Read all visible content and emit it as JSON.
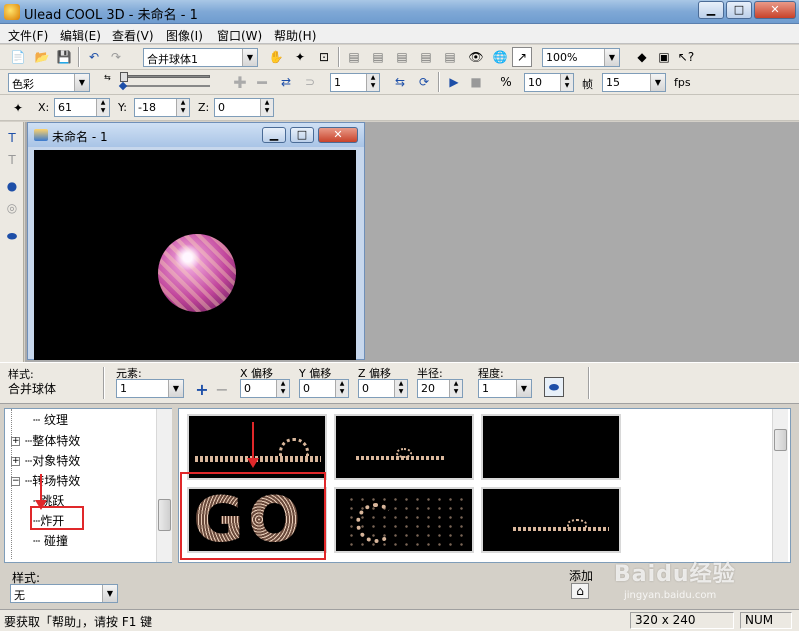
{
  "window": {
    "title": "Ulead COOL 3D - 未命名 - 1"
  },
  "menu": [
    "文件(F)",
    "编辑(E)",
    "查看(V)",
    "图像(I)",
    "窗口(W)",
    "帮助(H)"
  ],
  "toolbar1": {
    "object_combo": "合并球体1",
    "zoom_combo": "100%"
  },
  "toolbar2": {
    "color_combo": "色彩",
    "frame_value": "1",
    "frame_rate_value": "10",
    "frame_label": "帧",
    "fps_value": "15",
    "fps_label": "fps"
  },
  "toolbar3": {
    "x_label": "X:",
    "x_value": "61",
    "y_label": "Y:",
    "y_value": "-18",
    "z_label": "Z:",
    "z_value": "0"
  },
  "document": {
    "title": "未命名 - 1"
  },
  "props": {
    "style_label": "样式:",
    "style_value": "合并球体",
    "element_label": "元素:",
    "element_value": "1",
    "x_offset_label": "X 偏移",
    "x_offset_value": "0",
    "y_offset_label": "Y 偏移",
    "y_offset_value": "0",
    "z_offset_label": "Z 偏移",
    "z_offset_value": "0",
    "radius_label": "半径:",
    "radius_value": "20",
    "degree_label": "程度:",
    "degree_value": "1"
  },
  "tree": {
    "items": [
      "纹理",
      "整体特效",
      "对象特效",
      "转场特效",
      "跳跃",
      "炸开",
      "碰撞"
    ]
  },
  "thumbs": {
    "items": [
      "",
      "",
      "",
      "GO",
      "",
      ""
    ]
  },
  "bottom": {
    "style_label": "样式:",
    "style_value": "无",
    "add_label": "添加"
  },
  "status": {
    "hint": "要获取「帮助」，请按 F1 键",
    "size": "320 x 240",
    "num": "NUM"
  },
  "watermark": {
    "text": "Baidu经验",
    "sub": "jingyan.baidu.com"
  },
  "colors": {
    "title_bar": "#7fa8d6",
    "highlight": "#e0282a",
    "workspace": "#aaaaaa"
  }
}
